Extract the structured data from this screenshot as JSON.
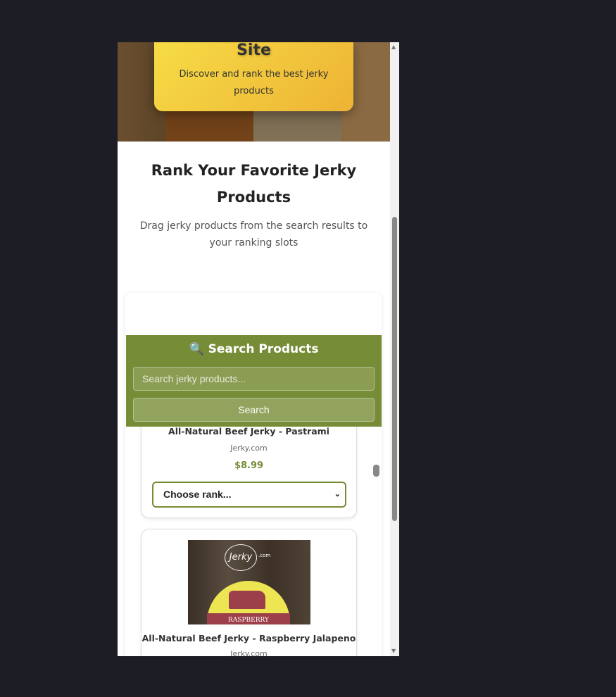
{
  "hero": {
    "title": "Site",
    "subtitle": "Discover and rank the best jerky products"
  },
  "main": {
    "title": "Rank Your Favorite Jerky Products",
    "subtitle": "Drag jerky products from the search results to your ranking slots"
  },
  "search": {
    "icon": "magnifying-glass-icon",
    "title": "Search Products",
    "placeholder": "Search jerky products...",
    "button": "Search"
  },
  "products": [
    {
      "name": "All-Natural Beef Jerky - Pastrami",
      "brand": "Jerky.com",
      "price": "$8.99",
      "rank_select": "Choose rank..."
    },
    {
      "name": "All-Natural Beef Jerky - Raspberry Jalapeno",
      "brand": "Jerky.com",
      "image_label": "RASPBERRY",
      "logo": "Jerky.com"
    }
  ],
  "colors": {
    "accent": "#768c36",
    "hero": "#f2c93e",
    "background": "#1c1d25"
  }
}
